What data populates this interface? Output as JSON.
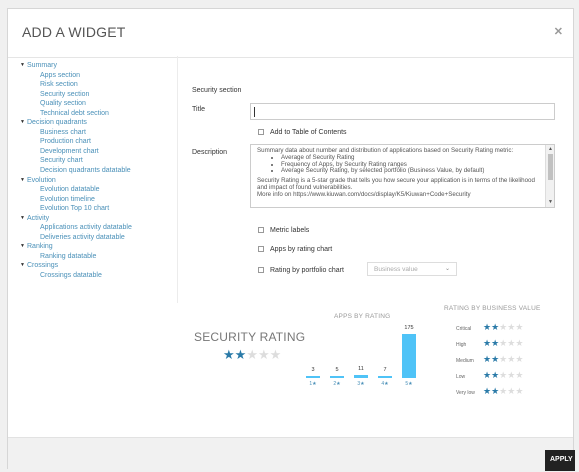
{
  "modal": {
    "title": "ADD A WIDGET",
    "close_icon": "close-icon",
    "apply_label": "APPLY"
  },
  "tree": [
    {
      "label": "Summary",
      "children": [
        "Apps section",
        "Risk section",
        "Security section",
        "Quality section",
        "Technical debt section"
      ]
    },
    {
      "label": "Decision quadrants",
      "children": [
        "Business chart",
        "Production chart",
        "Development chart",
        "Security chart",
        "Decision quadrants datatable"
      ]
    },
    {
      "label": "Evolution",
      "children": [
        "Evolution datatable",
        "Evolution timeline",
        "Evolution Top 10 chart"
      ]
    },
    {
      "label": "Activity",
      "children": [
        "Applications activity datatable",
        "Deliveries activity datatable"
      ]
    },
    {
      "label": "Ranking",
      "children": [
        "Ranking datatable"
      ]
    },
    {
      "label": "Crossings",
      "children": [
        "Crossings datatable"
      ]
    }
  ],
  "form": {
    "section_heading": "Security section",
    "title_label": "Title",
    "title_value": "",
    "add_toc_label": "Add to Table of Contents",
    "description_label": "Description",
    "description": {
      "intro": "Summary data about number and distribution of applications based on Security Rating metric:",
      "bullets": [
        "Average of Security Rating",
        "Frequency of Apps, by Security Rating ranges",
        "Average Security Rating, by selected portfolio (Business Value, by default)"
      ],
      "para": "Security Rating is a 5-star grade that tells you how secure your application is in terms of the likelihood and impact of found vulnerabilities.",
      "more": "More info on https://www.kiuwan.com/docs/display/K5/Kiuwan+Code+Security"
    },
    "metric_labels": "Metric labels",
    "apps_by_rating": "Apps by rating chart",
    "rating_by_portfolio": "Rating by portfolio chart",
    "portfolio_select": "Business value"
  },
  "preview": {
    "security_rating_title": "SECURITY RATING",
    "security_rating_stars": 2,
    "apps_by_rating_title": "APPS BY RATING",
    "rating_by_bv_title": "RATING BY BUSINESS VALUE"
  },
  "chart_data": [
    {
      "type": "bar",
      "title": "APPS BY RATING",
      "categories": [
        "1★",
        "2★",
        "3★",
        "4★",
        "5★"
      ],
      "values": [
        3,
        5,
        11,
        7,
        175
      ],
      "color": "#4fc3f7"
    }
  ],
  "rating_by_business_value": [
    {
      "label": "Critical",
      "stars": 2
    },
    {
      "label": "High",
      "stars": 2
    },
    {
      "label": "Medium",
      "stars": 2
    },
    {
      "label": "Low",
      "stars": 2
    },
    {
      "label": "Very low",
      "stars": 2
    }
  ],
  "colors": {
    "star_on": "#2a7aa8",
    "star_off": "#dddddd",
    "bar": "#4fc3f7",
    "link": "#4a90b8"
  }
}
